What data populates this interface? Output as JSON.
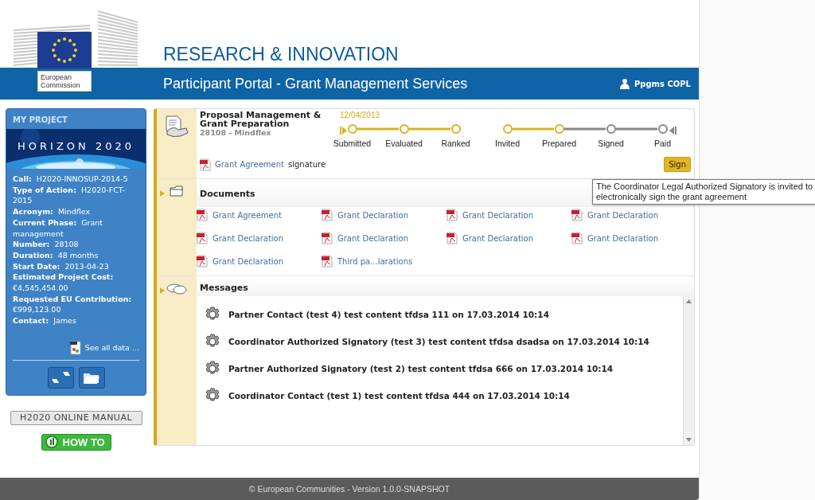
{
  "logo": {
    "caption": "European Commission"
  },
  "header": {
    "title": "RESEARCH & INNOVATION",
    "subtitle": "Participant Portal - Grant Management Services",
    "user": "Ppgms COPL"
  },
  "sidebar": {
    "title": "MY PROJECT",
    "banner": "HORIZON 2020",
    "fields": [
      {
        "label": "Call:",
        "value": "H2020-INNOSUP-2014-5"
      },
      {
        "label": "Type of Action:",
        "value": "H2020-FCT-2015"
      },
      {
        "label": "Acronym:",
        "value": "Mindflex"
      },
      {
        "label": "Current Phase:",
        "value": "Grant management"
      },
      {
        "label": "Number:",
        "value": "28108"
      },
      {
        "label": "Duration:",
        "value": "48 months"
      },
      {
        "label": "Start Date:",
        "value": "2013-04-23"
      },
      {
        "label": "Estimated Project Cost:",
        "value": "€4,545,454.00"
      },
      {
        "label": "Requested EU Contribution:",
        "value": "€999,123.00"
      },
      {
        "label": "Contact:",
        "value": "James"
      }
    ],
    "see_all": "See all data ...",
    "manual_button": "H2020 ONLINE MANUAL",
    "howto_button": "HOW TO"
  },
  "process": {
    "title": "Proposal Management & Grant Preparation",
    "subtitle": "28108 - Mindflex",
    "date": "12/04/2013",
    "phases": [
      {
        "steps": [
          {
            "label": "Submitted",
            "done": true
          },
          {
            "label": "Evaluated",
            "done": true
          },
          {
            "label": "Ranked",
            "done": true
          }
        ]
      },
      {
        "steps": [
          {
            "label": "Invited",
            "done": true
          },
          {
            "label": "Prepared",
            "done": true
          },
          {
            "label": "Signed",
            "done": false
          },
          {
            "label": "Paid",
            "done": false
          }
        ]
      }
    ],
    "action": {
      "link": "Grant Agreement",
      "text": "signature",
      "button": "Sign"
    },
    "tooltip": "The Coordinator Legal Authorized Signatory is invited to electronically sign the grant agreement"
  },
  "documents": {
    "title": "Documents",
    "items": [
      "Grant Agreement",
      "Grant Declaration",
      "Grant Declaration",
      "Grant Declaration",
      "Grant Declaration",
      "Grant Declaration",
      "Grant Declaration",
      "Grant Declaration",
      "Grant Declaration",
      "Third pa...larations"
    ]
  },
  "messages": {
    "title": "Messages",
    "items": [
      "Partner Contact (test 4) test content tfdsa 111 on 17.03.2014 10:14",
      "Coordinator Authorized Signatory (test 3) test content tfdsa dsadsa on 17.03.2014 10:14",
      "Partner Authorized Signatory (test 2) test content tfdsa 666 on 17.03.2014 10:14",
      "Coordinator Contact (test 1) test content tfdsa 444 on 17.03.2014 10:14"
    ]
  },
  "footer": "© European Communities - Version 1.0.0-SNAPSHOT"
}
